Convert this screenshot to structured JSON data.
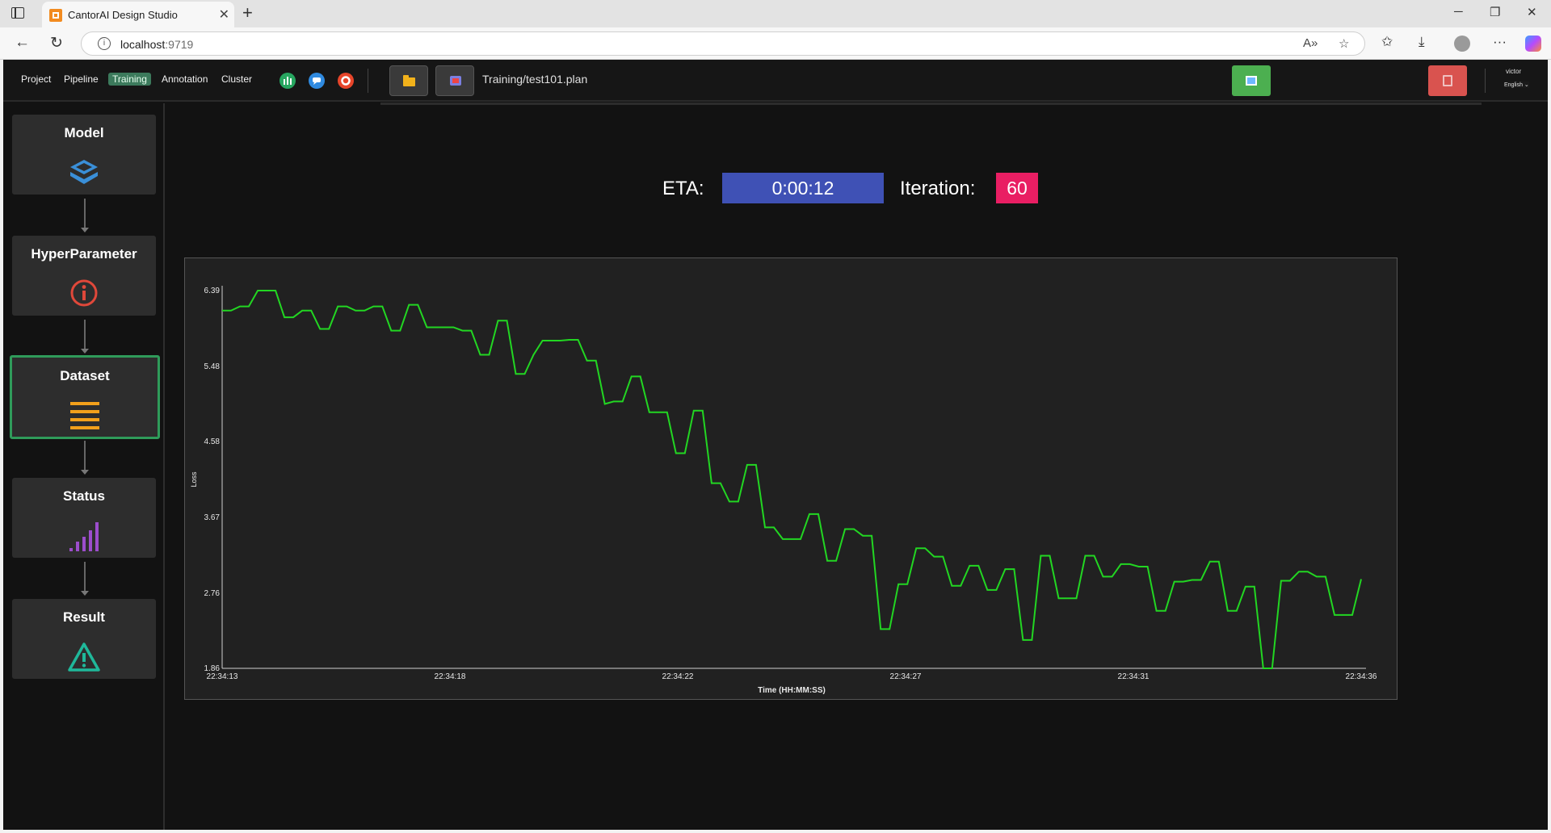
{
  "browser": {
    "tab_title": "CantorAI Design Studio",
    "url_host": "localhost",
    "url_port": ":9719"
  },
  "topnav": {
    "menu": [
      "Project",
      "Pipeline",
      "Training",
      "Annotation",
      "Cluster"
    ],
    "active_menu": "Training",
    "plan_path": "Training/test101.plan",
    "user": "victor",
    "language": "English"
  },
  "sidebar": {
    "steps": [
      {
        "title": "Model",
        "icon": "layers-icon",
        "color": "#3a8fd8"
      },
      {
        "title": "HyperParameter",
        "icon": "info-circle-icon",
        "color": "#e0483a"
      },
      {
        "title": "Dataset",
        "icon": "list-icon",
        "color": "#f2a01b",
        "active": true
      },
      {
        "title": "Status",
        "icon": "signal-bars-icon",
        "color": "#9c4dcc"
      },
      {
        "title": "Result",
        "icon": "warning-triangle-icon",
        "color": "#1fb89a"
      }
    ]
  },
  "training": {
    "eta_label": "ETA:",
    "eta_value": "0:00:12",
    "iteration_label": "Iteration:",
    "iteration_value": "60"
  },
  "chart_data": {
    "type": "line",
    "xlabel": "Time (HH:MM:SS)",
    "ylabel": "Loss",
    "x_ticks": [
      "22:34:13",
      "22:34:18",
      "22:34:22",
      "22:34:27",
      "22:34:31",
      "22:34:36"
    ],
    "y_ticks": [
      1.86,
      2.76,
      3.67,
      4.58,
      5.48,
      6.39
    ],
    "ylim": [
      1.86,
      6.39
    ],
    "series_color": "#22d622",
    "series": [
      {
        "values": [
          6.15,
          6.15,
          6.2,
          6.2,
          6.39,
          6.39,
          6.39,
          6.07,
          6.07,
          6.15,
          6.15,
          5.93,
          5.93,
          6.2,
          6.2,
          6.15,
          6.15,
          6.2,
          6.2,
          5.91,
          5.91,
          6.22,
          6.22,
          5.95,
          5.95,
          5.95,
          5.95,
          5.91,
          5.91,
          5.62,
          5.62,
          6.03,
          6.03,
          5.39,
          5.39,
          5.62,
          5.79,
          5.79,
          5.79,
          5.8,
          5.8,
          5.55,
          5.55,
          5.03,
          5.06,
          5.06,
          5.36,
          5.36,
          4.93,
          4.93,
          4.93,
          4.44,
          4.44,
          4.95,
          4.95,
          4.08,
          4.08,
          3.86,
          3.86,
          4.3,
          4.3,
          3.55,
          3.55,
          3.41,
          3.41,
          3.41,
          3.71,
          3.71,
          3.15,
          3.15,
          3.53,
          3.53,
          3.45,
          3.45,
          2.33,
          2.33,
          2.87,
          2.87,
          3.3,
          3.3,
          3.2,
          3.2,
          2.85,
          2.85,
          3.09,
          3.09,
          2.8,
          2.8,
          3.05,
          3.05,
          2.2,
          2.2,
          3.21,
          3.21,
          2.7,
          2.7,
          2.7,
          3.21,
          3.21,
          2.96,
          2.96,
          3.11,
          3.11,
          3.08,
          3.08,
          2.55,
          2.55,
          2.9,
          2.9,
          2.92,
          2.92,
          3.14,
          3.14,
          2.55,
          2.55,
          2.84,
          2.84,
          1.86,
          1.86,
          2.91,
          2.91,
          3.02,
          3.02,
          2.96,
          2.96,
          2.5,
          2.5,
          2.5,
          2.93
        ]
      }
    ],
    "grid": false
  }
}
